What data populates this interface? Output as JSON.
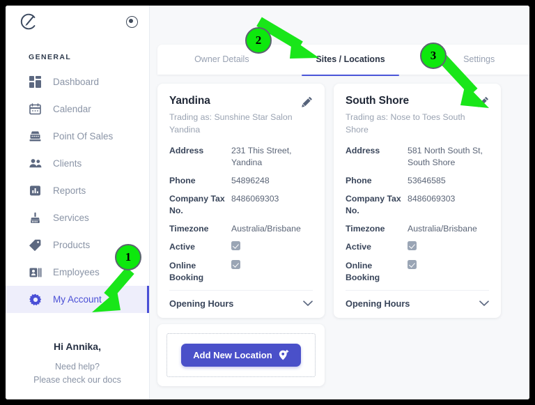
{
  "app": {
    "logo_icon": "brand-c-logo",
    "collapse_icon": "collapse-toggle-icon"
  },
  "sidebar": {
    "section_label": "GENERAL",
    "items": [
      {
        "label": "Dashboard",
        "icon": "dashboard-icon",
        "active": false
      },
      {
        "label": "Calendar",
        "icon": "calendar-icon",
        "active": false
      },
      {
        "label": "Point Of Sales",
        "icon": "register-icon",
        "active": false
      },
      {
        "label": "Clients",
        "icon": "clients-icon",
        "active": false
      },
      {
        "label": "Reports",
        "icon": "reports-icon",
        "active": false
      },
      {
        "label": "Services",
        "icon": "services-icon",
        "active": false
      },
      {
        "label": "Products",
        "icon": "products-tag-icon",
        "active": false
      },
      {
        "label": "Employees",
        "icon": "employees-icon",
        "active": false
      },
      {
        "label": "My Account",
        "icon": "gear-icon",
        "active": true
      }
    ],
    "footer": {
      "greeting": "Hi Annika,",
      "help_line1": "Need help?",
      "help_line2": "Please check our docs"
    }
  },
  "tabs": [
    {
      "label": "Owner Details",
      "active": false
    },
    {
      "label": "Sites / Locations",
      "active": true
    },
    {
      "label": "Settings",
      "active": false
    }
  ],
  "locations": [
    {
      "title": "Yandina",
      "trading_as": "Trading as: Sunshine Star Salon Yandina",
      "edit_icon": "pencil-icon",
      "fields": [
        {
          "key": "Address",
          "value": "231 This Street, Yandina",
          "type": "text"
        },
        {
          "key": "Phone",
          "value": "54896248",
          "type": "text"
        },
        {
          "key": "Company Tax No.",
          "value": "8486069303",
          "type": "text"
        },
        {
          "key": "Timezone",
          "value": "Australia/Brisbane",
          "type": "text"
        },
        {
          "key": "Active",
          "value": "checked",
          "type": "checkbox"
        },
        {
          "key": "Online Booking",
          "value": "checked",
          "type": "checkbox"
        }
      ],
      "opening_hours_label": "Opening Hours",
      "opening_hours_icon": "chevron-down-icon"
    },
    {
      "title": "South Shore",
      "trading_as": "Trading as: Nose to Toes South Shore",
      "edit_icon": "pencil-icon",
      "fields": [
        {
          "key": "Address",
          "value": "581 North South St, South Shore",
          "type": "text"
        },
        {
          "key": "Phone",
          "value": "53646585",
          "type": "text"
        },
        {
          "key": "Company Tax No.",
          "value": "8486069303",
          "type": "text"
        },
        {
          "key": "Timezone",
          "value": "Australia/Brisbane",
          "type": "text"
        },
        {
          "key": "Active",
          "value": "checked",
          "type": "checkbox"
        },
        {
          "key": "Online Booking",
          "value": "checked",
          "type": "checkbox"
        }
      ],
      "opening_hours_label": "Opening Hours",
      "opening_hours_icon": "chevron-down-icon"
    }
  ],
  "add_location": {
    "label": "Add New Location",
    "icon": "map-pin-plus-icon"
  },
  "annotations": [
    {
      "number": "1",
      "target": "sidebar-item-my-account"
    },
    {
      "number": "2",
      "target": "tab-sites-locations"
    },
    {
      "number": "3",
      "target": "edit-south-shore"
    }
  ],
  "colors": {
    "accent": "#4a50c9",
    "annotation_green": "#0de80d",
    "active_nav_bg": "#eeeefb",
    "page_bg": "#f7f8fa"
  }
}
